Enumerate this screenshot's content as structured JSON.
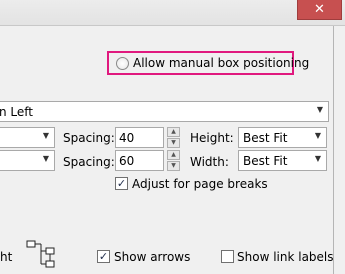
{
  "window": {
    "close_glyph": "✕"
  },
  "allow_manual": {
    "label": "Allow manual box positioning",
    "checked": false
  },
  "layout_combo": {
    "value": "n Left",
    "arrow": "▼"
  },
  "row1": {
    "spacing_label": "Spacing:",
    "spacing_value": "40",
    "height_label": "Height:",
    "height_value": "Best Fit"
  },
  "row2": {
    "spacing_label": "Spacing:",
    "spacing_value": "60",
    "width_label": "Width:",
    "width_value": "Best Fit"
  },
  "adjust_page_breaks": {
    "label": "Adjust for page breaks",
    "checked": true
  },
  "bottom": {
    "partial_label": "ht",
    "show_arrows_label": "Show arrows",
    "show_arrows_checked": true,
    "show_link_labels_label": "Show link labels",
    "show_link_labels_checked": false
  },
  "icons": {
    "close": "close-icon",
    "dropdown": "chevron-down-icon",
    "spin_up": "spin-up-icon",
    "spin_down": "spin-down-icon",
    "layout": "tree-layout-icon"
  },
  "colors": {
    "highlight": "#e0197e",
    "close_button": "#c75050"
  }
}
